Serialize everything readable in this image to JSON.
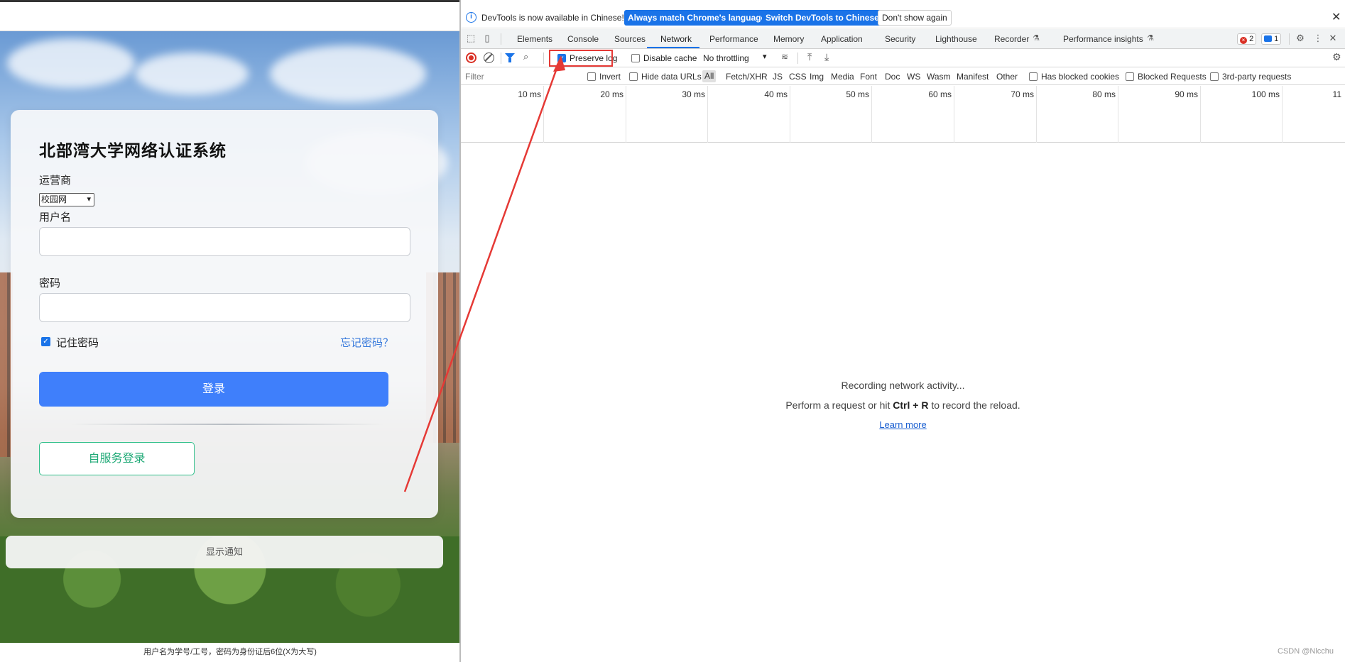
{
  "login_page": {
    "title": "北部湾大学网络认证系统",
    "carrier_label": "运营商",
    "carrier_selected": "校园网",
    "username_label": "用户名",
    "password_label": "密码",
    "remember_label": "记住密码",
    "remember_checked": true,
    "forgot_link": "忘记密码？",
    "login_button": "登录",
    "self_service_button": "自服务登录",
    "notice_button": "显示通知",
    "bottom_hint": "用户名为学号/工号，密码为身份证后6位(X为大写)"
  },
  "devtools": {
    "infobar": {
      "text": "DevTools is now available in Chinese!",
      "btn_match": "Always match Chrome's language",
      "btn_switch": "Switch DevTools to Chinese",
      "btn_dismiss": "Don't show again"
    },
    "tabs": [
      "Elements",
      "Console",
      "Sources",
      "Network",
      "Performance",
      "Memory",
      "Application",
      "Security",
      "Lighthouse",
      "Recorder",
      "Performance insights"
    ],
    "active_tab": "Network",
    "badges": {
      "errors": "2",
      "messages": "1"
    },
    "toolbar": {
      "preserve_log": "Preserve log",
      "disable_cache": "Disable cache",
      "throttling": "No throttling"
    },
    "filterbar": {
      "placeholder": "Filter",
      "invert": "Invert",
      "hide_data_urls": "Hide data URLs",
      "types": [
        "All",
        "Fetch/XHR",
        "JS",
        "CSS",
        "Img",
        "Media",
        "Font",
        "Doc",
        "WS",
        "Wasm",
        "Manifest",
        "Other"
      ],
      "has_blocked_cookies": "Has blocked cookies",
      "blocked_requests": "Blocked Requests",
      "third_party": "3rd-party requests"
    },
    "timeline_ticks": [
      "10 ms",
      "20 ms",
      "30 ms",
      "40 ms",
      "50 ms",
      "60 ms",
      "70 ms",
      "80 ms",
      "90 ms",
      "100 ms",
      "11"
    ],
    "empty_state": {
      "title": "Recording network activity...",
      "sub_prefix": "Perform a request or hit",
      "shortcut": "Ctrl + R",
      "sub_suffix": "to record the reload.",
      "learn_more": "Learn more"
    }
  },
  "watermark": "CSDN @Nlcchu",
  "annotation_color": "#e53935"
}
